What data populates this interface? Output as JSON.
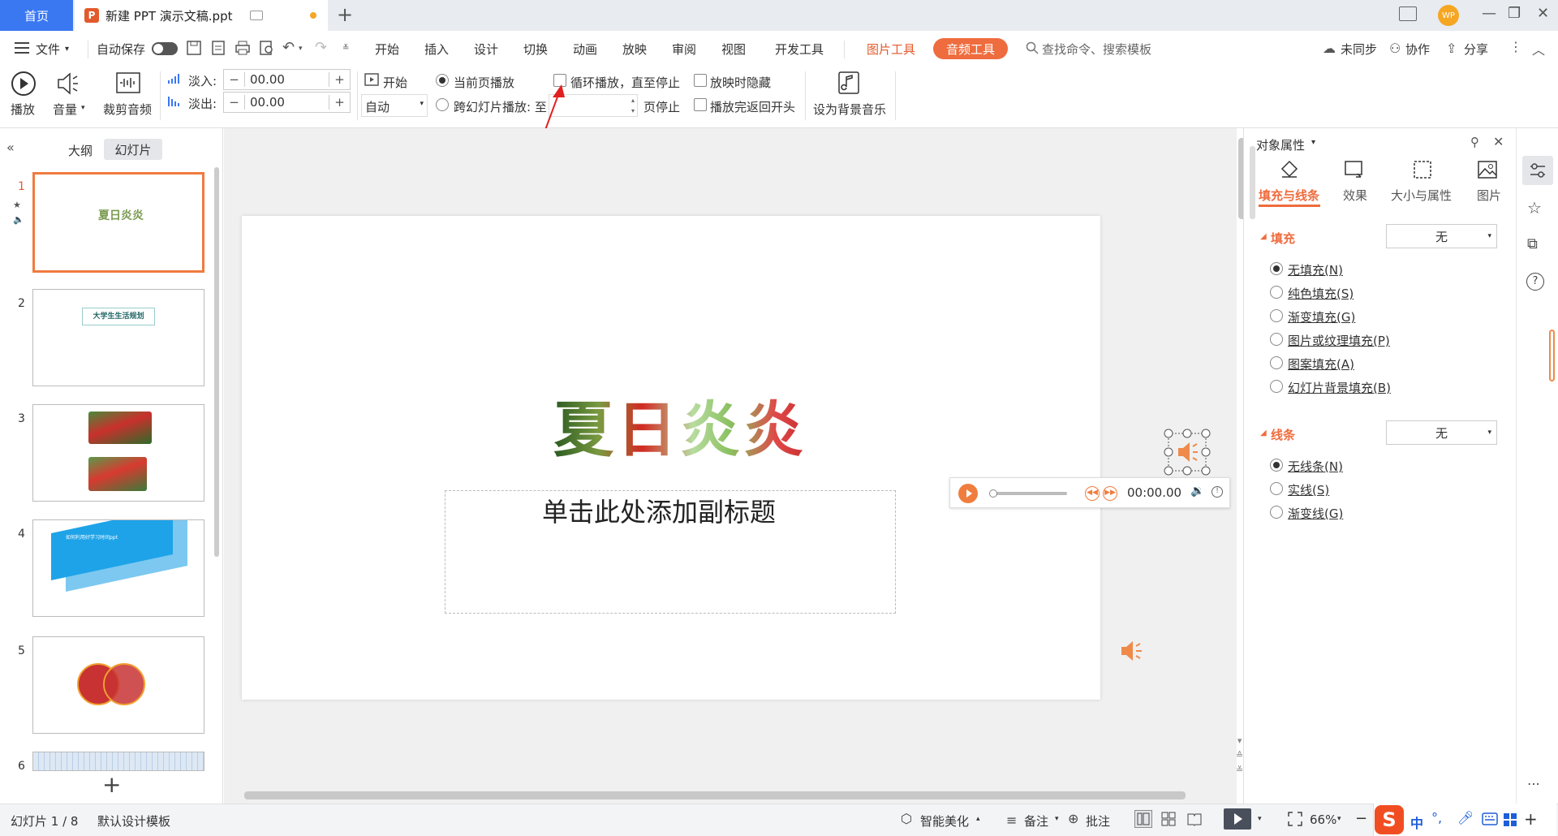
{
  "titlebar": {
    "home_tab": "首页",
    "doc_name": "新建 PPT 演示文稿.ppt",
    "ppt_logo": "P",
    "new_tab": "+",
    "avatar": "WP",
    "window_controls": [
      "—",
      "❐",
      "✕"
    ]
  },
  "menu": {
    "file": "文件",
    "autosave": "自动保存",
    "items": [
      "开始",
      "插入",
      "设计",
      "切换",
      "动画",
      "放映",
      "审阅",
      "视图",
      "开发工具"
    ],
    "picture_tools": "图片工具",
    "audio_tools": "音频工具",
    "search": "查找命令、搜索模板",
    "unsynced": "未同步",
    "collaborate": "协作",
    "share": "分享"
  },
  "ribbon": {
    "play": "播放",
    "volume": "音量",
    "trim": "裁剪音频",
    "fade_in_label": "淡入:",
    "fade_in_value": "00.00",
    "fade_out_label": "淡出:",
    "fade_out_value": "00.00",
    "start_label": "开始",
    "start_value": "自动",
    "current_page": "当前页播放",
    "cross_slide": "跨幻灯片播放: 至",
    "page_stop": "页停止",
    "loop": "循环播放，直至停止",
    "hide_on_show": "放映时隐藏",
    "rewind": "播放完返回开头",
    "set_bg_music": "设为背景音乐"
  },
  "left_panel": {
    "outline_tab": "大纲",
    "slides_tab": "幻灯片",
    "slide_numbers": [
      "1",
      "2",
      "3",
      "4",
      "5",
      "6"
    ],
    "add": "+",
    "slide2_text": "大学生生活规划",
    "slide4_text": "如何利用好学习时间ppt"
  },
  "slide": {
    "title": "夏日炎炎",
    "subtitle_placeholder": "单击此处添加副标题"
  },
  "audio_player": {
    "time": "00:00.00"
  },
  "right_panel": {
    "header": "对象属性",
    "tabs": [
      "填充与线条",
      "效果",
      "大小与属性",
      "图片"
    ],
    "fill_section": "填充",
    "fill_value": "无",
    "fill_options": [
      "无填充(N)",
      "纯色填充(S)",
      "渐变填充(G)",
      "图片或纹理填充(P)",
      "图案填充(A)",
      "幻灯片背景填充(B)"
    ],
    "line_section": "线条",
    "line_value": "无",
    "line_options": [
      "无线条(N)",
      "实线(S)",
      "渐变线(G)"
    ]
  },
  "status": {
    "slide_count": "幻灯片 1 / 8",
    "template": "默认设计模板",
    "beautify": "智能美化",
    "notes": "备注",
    "comments": "批注",
    "zoom": "66%",
    "ime": "中"
  },
  "colors": {
    "accent": "#3a78f2",
    "audio_accent": "#ef6c3e",
    "selection": "#f07b3f"
  }
}
